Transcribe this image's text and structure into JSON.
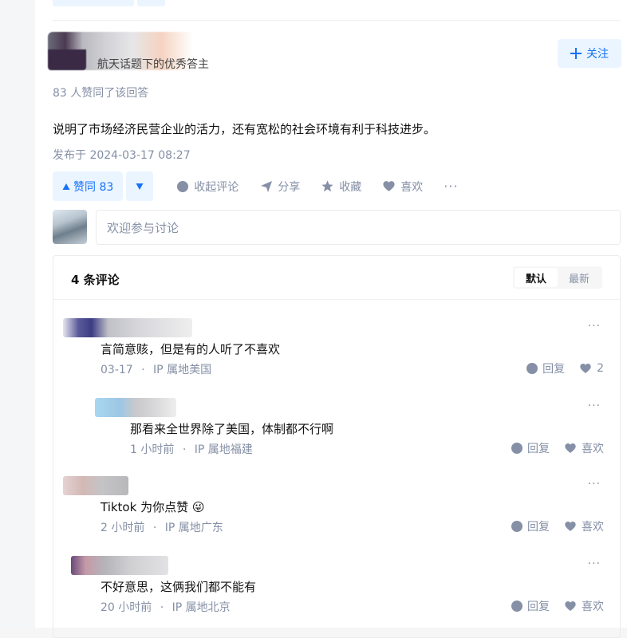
{
  "answer": {
    "author_badge": "航天话题下的优秀答主",
    "follow_label": "关注",
    "vote_summary": "83 人赞同了该回答",
    "content": "说明了市场经济民营企业的活力，还有宽松的社会环境有利于科技进步。",
    "published": "发布于 2024-03-17 08:27"
  },
  "actions": {
    "upvote_label": "赞同 83",
    "collapse_comments": "收起评论",
    "share": "分享",
    "favorite": "收藏",
    "like": "喜欢",
    "more": "···"
  },
  "comment_input": {
    "placeholder": "欢迎参与讨论"
  },
  "comments_panel": {
    "count_label": "4 条评论",
    "sort_default": "默认",
    "sort_latest": "最新"
  },
  "comments": [
    {
      "text": "言简意赅，但是有的人听了不喜欢",
      "time": "03-17",
      "location": "IP 属地美国",
      "reply": "回复",
      "likes": "2"
    },
    {
      "text": "那看来全世界除了美国，体制都不行啊",
      "time": "1 小时前",
      "location": "IP 属地福建",
      "reply": "回复",
      "like": "喜欢"
    },
    {
      "text": "Tiktok 为你点赞",
      "emoji": "😜",
      "time": "2 小时前",
      "location": "IP 属地广东",
      "reply": "回复",
      "like": "喜欢"
    },
    {
      "text": "不好意思，这俩我们都不能有",
      "time": "20 小时前",
      "location": "IP 属地北京",
      "reply": "回复",
      "like": "喜欢"
    }
  ],
  "meta_separator": "·",
  "colors": {
    "accent": "#1772f6",
    "muted": "#8590a6",
    "accent_bg": "#ebf5ff"
  }
}
